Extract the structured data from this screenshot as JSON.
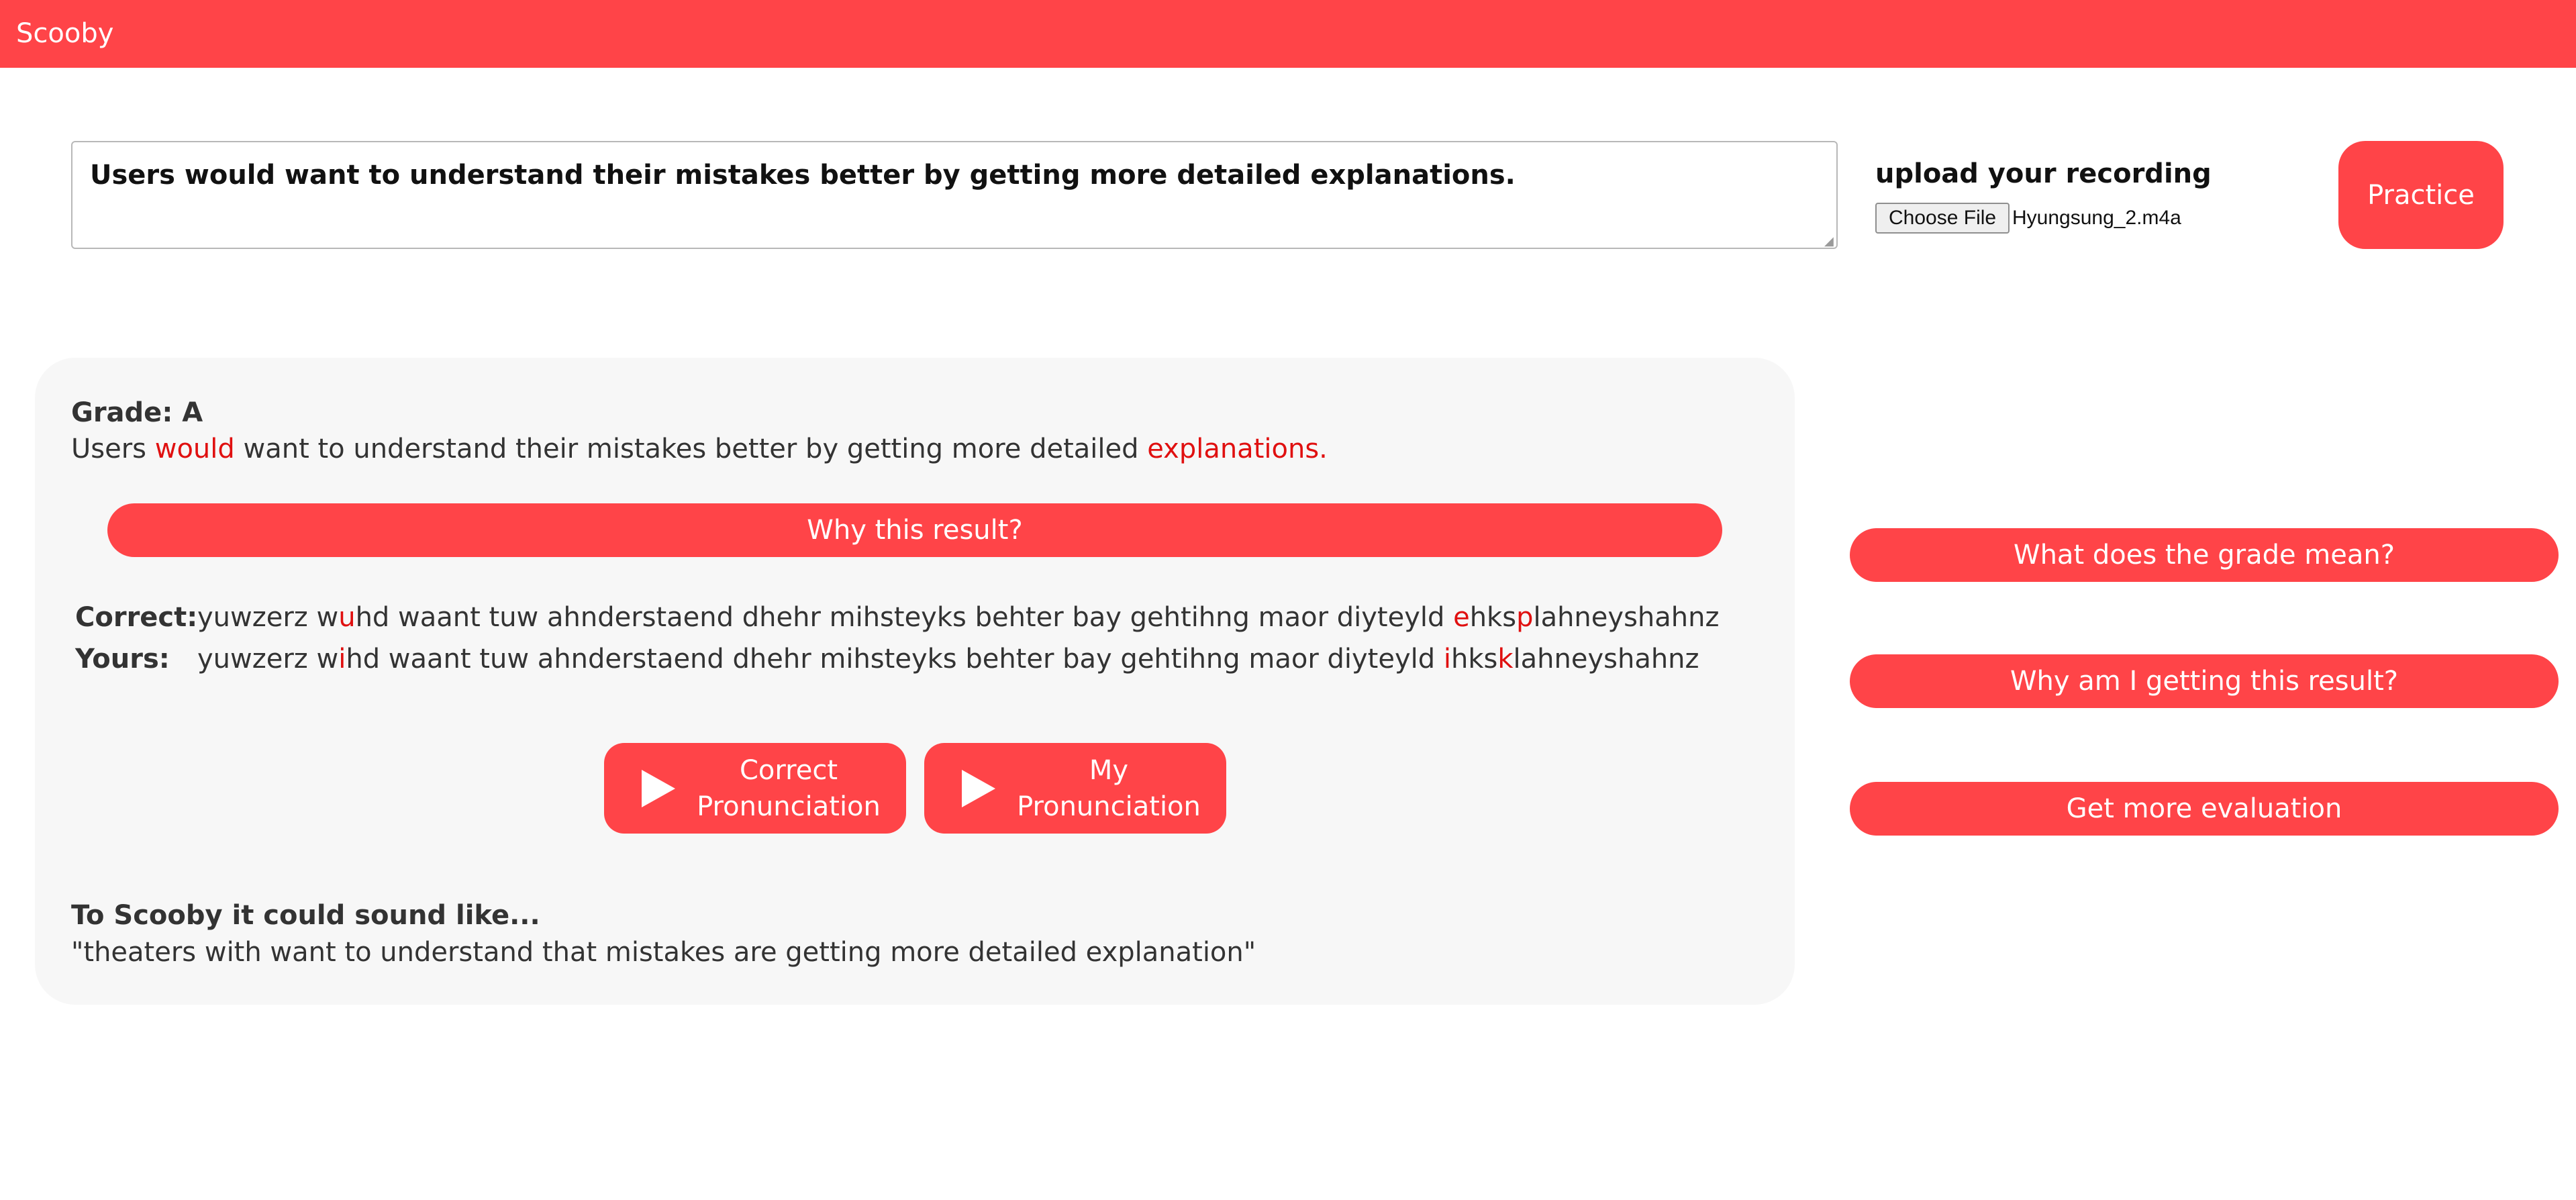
{
  "app": {
    "title": "Scooby",
    "accent_color": "#ff4448",
    "error_color": "#e01010"
  },
  "input": {
    "sentence": "Users would want to understand their mistakes better by getting more detailed explanations."
  },
  "upload": {
    "label": "upload your recording",
    "choose_file_label": "Choose File",
    "file_name": "Hyungsung_2.m4a"
  },
  "practice_label": "Practice",
  "result": {
    "grade_text": "Grade: A",
    "sentence_segments": [
      {
        "text": "Users ",
        "error": false
      },
      {
        "text": "would",
        "error": true
      },
      {
        "text": " want to understand their mistakes better by getting more detailed ",
        "error": false
      },
      {
        "text": "explanations.",
        "error": true
      }
    ],
    "why_button": "Why this result?",
    "correct_label": "Correct:",
    "yours_label": "Yours:",
    "correct_segments": [
      {
        "text": "yuwzerz w",
        "error": false
      },
      {
        "text": "u",
        "error": true
      },
      {
        "text": "hd waant tuw ahnderstaend dhehr mihsteyks behter bay gehtihng maor diyteyld ",
        "error": false
      },
      {
        "text": "e",
        "error": true
      },
      {
        "text": "hks",
        "error": false
      },
      {
        "text": "p",
        "error": true
      },
      {
        "text": "lahneyshahnz",
        "error": false
      }
    ],
    "yours_segments": [
      {
        "text": "yuwzerz w",
        "error": false
      },
      {
        "text": "i",
        "error": true
      },
      {
        "text": "hd waant tuw ahnderstaend dhehr mihsteyks behter bay gehtihng maor diyteyld ",
        "error": false
      },
      {
        "text": "i",
        "error": true
      },
      {
        "text": "hks",
        "error": false
      },
      {
        "text": "k",
        "error": true
      },
      {
        "text": "lahneyshahnz",
        "error": false
      }
    ],
    "correct_pron_line1": "Correct",
    "correct_pron_line2": "Pronunciation",
    "my_pron_line1": "My",
    "my_pron_line2": "Pronunciation",
    "sound_like_title": "To Scooby it could sound like...",
    "sound_like_text": "\"theaters with want to understand that mistakes are getting more detailed explanation\""
  },
  "sidebar": {
    "grade_meaning": "What does the grade mean?",
    "why_getting": "Why am I getting this result?",
    "more_evaluation": "Get more evaluation"
  }
}
